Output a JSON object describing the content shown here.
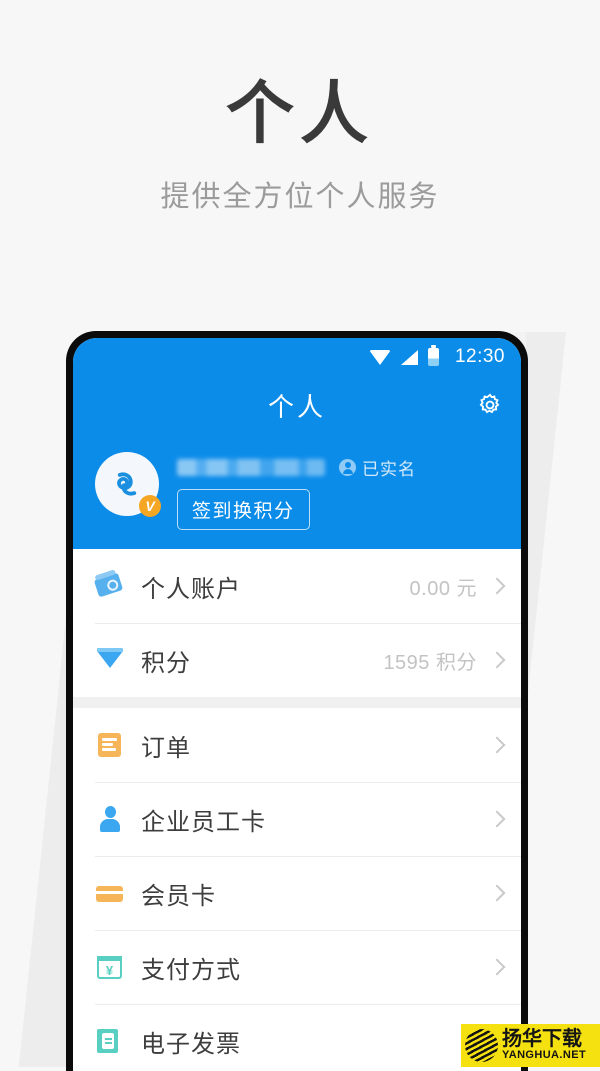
{
  "promo": {
    "title": "个人",
    "subtitle": "提供全方位个人服务"
  },
  "phone": {
    "statusbar": {
      "clock": "12:30",
      "icons": [
        "wifi-icon",
        "signal-icon",
        "battery-icon"
      ]
    },
    "appbar": {
      "title": "个人",
      "settings_icon": "gear-icon"
    },
    "profile": {
      "avatar_icon": "app-logo-avatar",
      "verified_badge": "V",
      "username": "",
      "verified_label": "已实名",
      "verified_icon": "person-circle-icon",
      "signin_button": "签到换积分"
    },
    "list_groups": [
      {
        "rows": [
          {
            "icon": "wallet-icon",
            "label": "个人账户",
            "value": "0.00 元",
            "chevron": "chevron-right-icon"
          },
          {
            "icon": "gem-icon",
            "label": "积分",
            "value": "1595 积分",
            "chevron": "chevron-right-icon"
          }
        ]
      },
      {
        "rows": [
          {
            "icon": "order-document-icon",
            "label": "订单",
            "value": "",
            "chevron": "chevron-right-icon"
          },
          {
            "icon": "employee-person-icon",
            "label": "企业员工卡",
            "value": "",
            "chevron": "chevron-right-icon"
          },
          {
            "icon": "membership-card-icon",
            "label": "会员卡",
            "value": "",
            "chevron": "chevron-right-icon"
          },
          {
            "icon": "payment-yuan-icon",
            "label": "支付方式",
            "value": "",
            "chevron": "chevron-right-icon"
          },
          {
            "icon": "invoice-icon",
            "label": "电子发票",
            "value": "",
            "chevron": "chevron-right-icon"
          }
        ]
      }
    ]
  },
  "watermark": {
    "cn": "扬华下载",
    "en": "YANGHUA.NET",
    "icon": "globe-logo-icon"
  },
  "colors": {
    "brand_blue": "#0c8ce9",
    "page_bg": "#f7f7f7",
    "accent_orange": "#f7b559",
    "accent_teal": "#58cfc0",
    "watermark_yellow": "#f5e010"
  }
}
